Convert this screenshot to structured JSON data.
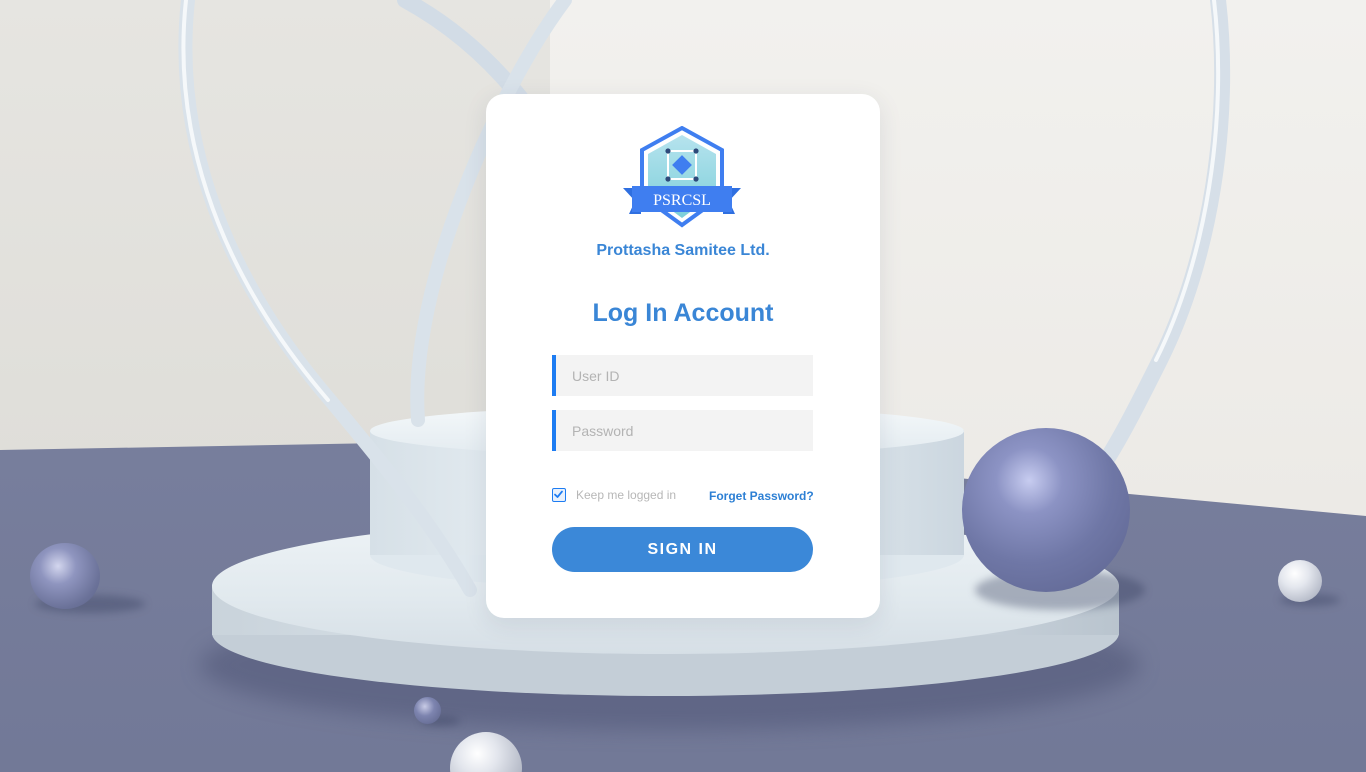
{
  "brand": {
    "logo_text": "PSRCSL",
    "organization": "Prottasha Samitee Ltd.",
    "primary_color": "#3a86d6",
    "accent_color": "#1d7cf2"
  },
  "login": {
    "title": "Log In Account",
    "user_id": {
      "placeholder": "User ID",
      "value": ""
    },
    "password": {
      "placeholder": "Password",
      "value": ""
    },
    "remember": {
      "label": "Keep me logged in",
      "checked": true
    },
    "forgot_label": "Forget Password?",
    "submit_label": "SIGN IN"
  }
}
